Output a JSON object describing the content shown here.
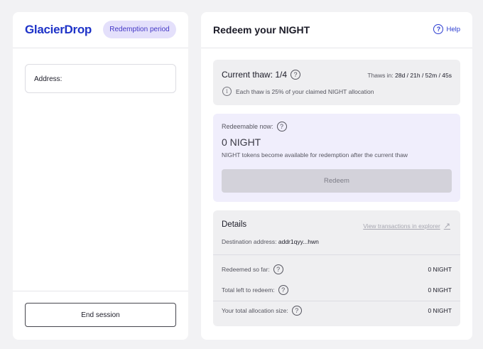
{
  "left": {
    "logo": "GlacierDrop",
    "badge": "Redemption period",
    "address_label": "Address:",
    "end_session": "End session"
  },
  "right": {
    "title": "Redeem your NIGHT",
    "help": "Help",
    "thaw": {
      "title": "Current thaw: 1/4",
      "thaws_in_label": "Thaws in:",
      "countdown": "28d / 21h / 52m / 45s",
      "note": "Each thaw is 25% of your claimed NIGHT allocation"
    },
    "redeemable": {
      "label": "Redeemable now:",
      "amount": "0 NIGHT",
      "note": "NIGHT tokens become available for redemption after the current thaw",
      "button": "Redeem"
    },
    "details": {
      "title": "Details",
      "explorer_link": "View transactions in explorer",
      "destination_label": "Destination address:",
      "destination_value": "addr1qyy...hwn",
      "rows": [
        {
          "label": "Redeemed so far:",
          "value": "0 NIGHT"
        },
        {
          "label": "Total left to redeem:",
          "value": "0 NIGHT"
        },
        {
          "label": "Your total allocation size:",
          "value": "0 NIGHT"
        }
      ]
    }
  },
  "colors": {
    "brand": "#1e33c8",
    "badge_bg": "#e4e0fb",
    "redeem_card_bg": "#f0eefc",
    "disabled_button": "#d3d2da"
  },
  "icons": {
    "help": "question-circle-icon",
    "info": "info-circle-icon",
    "external": "external-link-arrow-icon"
  }
}
